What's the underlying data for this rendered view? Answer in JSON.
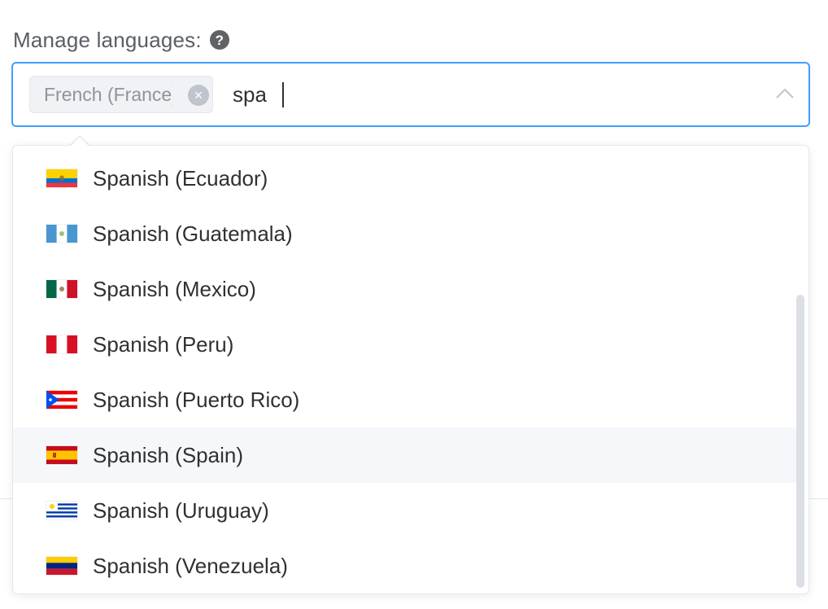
{
  "field": {
    "label": "Manage languages:",
    "help_icon_glyph": "?"
  },
  "select": {
    "selected_tags": [
      {
        "label": "French (France)"
      }
    ],
    "search_value": "spa",
    "tag_close_glyph": "×",
    "border_color": "#409eff"
  },
  "dropdown": {
    "hovered_index": 5,
    "options": [
      {
        "label": "Spanish (Ecuador)",
        "flag": "ecuador-flag-icon"
      },
      {
        "label": "Spanish (Guatemala)",
        "flag": "guatemala-flag-icon"
      },
      {
        "label": "Spanish (Mexico)",
        "flag": "mexico-flag-icon"
      },
      {
        "label": "Spanish (Peru)",
        "flag": "peru-flag-icon"
      },
      {
        "label": "Spanish (Puerto Rico)",
        "flag": "puerto-rico-flag-icon"
      },
      {
        "label": "Spanish (Spain)",
        "flag": "spain-flag-icon"
      },
      {
        "label": "Spanish (Uruguay)",
        "flag": "uruguay-flag-icon"
      },
      {
        "label": "Spanish (Venezuela)",
        "flag": "venezuela-flag-icon"
      }
    ]
  }
}
